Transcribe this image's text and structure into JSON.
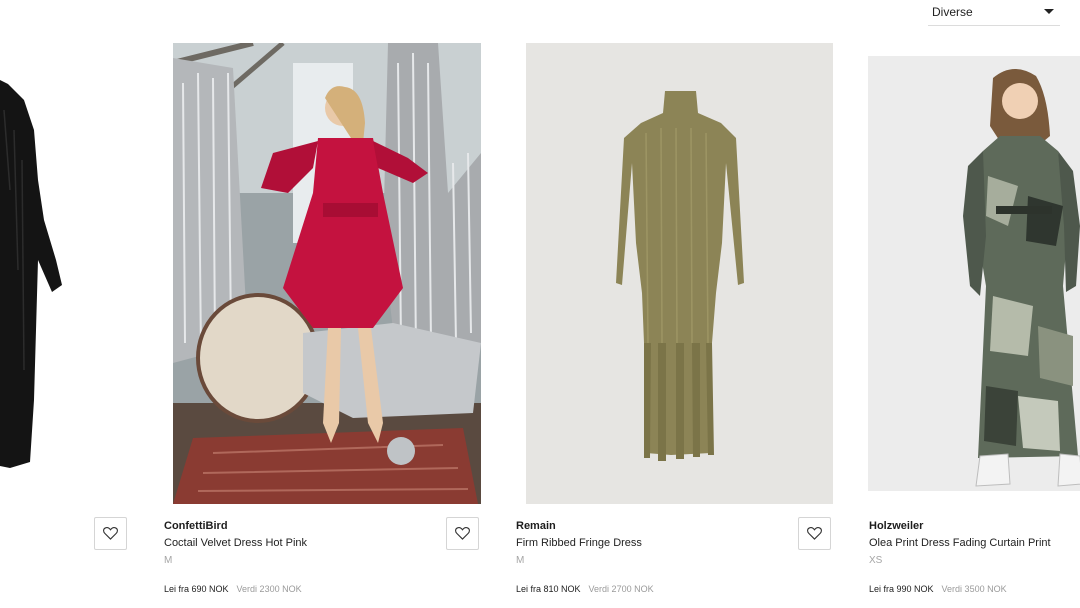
{
  "sort": {
    "label": "Diverse",
    "icon": "caret-down-icon"
  },
  "products": [
    {
      "brand": "ConfettiBird",
      "name": "Coctail Velvet Dress Hot Pink",
      "size": "M",
      "rent_price": "Lei fra 690 NOK",
      "retail_price": "Verdi 2300 NOK",
      "favorite_icon": "heart-icon",
      "image": "red wrap dress on model in studio with silver tinsel",
      "dress_color": "#c4123f"
    },
    {
      "brand": "Remain",
      "name": "Firm Ribbed Fringe Dress",
      "size": "M",
      "rent_price": "Lei fra 810 NOK",
      "retail_price": "Verdi 2700 NOK",
      "favorite_icon": "heart-icon",
      "image": "olive knit turtleneck fringe dress",
      "dress_color": "#8c8456"
    },
    {
      "brand": "Holzweiler",
      "name": "Olea Print Dress Fading Curtain Print",
      "size": "XS",
      "rent_price": "Lei fra 990 NOK",
      "retail_price": "Verdi 3500 NOK",
      "favorite_icon": "heart-icon",
      "image": "printed grey-green dress on model with sneakers",
      "dress_color": "#5e6a5a"
    }
  ],
  "previous_card": {
    "favorite_icon": "heart-icon",
    "image": "black long dress"
  }
}
